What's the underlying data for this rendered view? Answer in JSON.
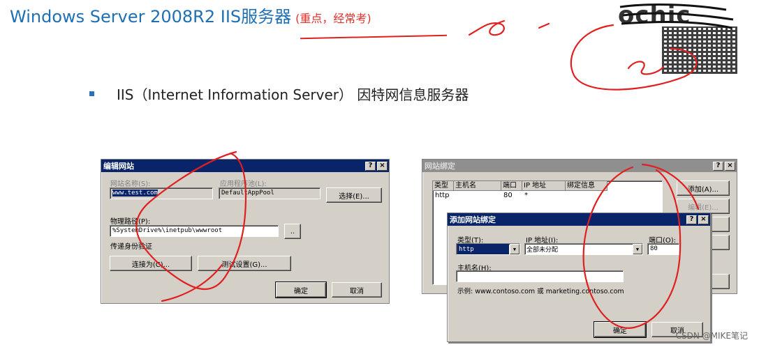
{
  "slide": {
    "title": "Windows Server 2008R2 IIS服务器",
    "title_note": "(重点，经常考)",
    "bullet": "IIS（Internet Information Server） 因特网信息服务器",
    "logo_text": "ochic",
    "watermark": "CSDN @MIKE笔记",
    "title_color": "#1f6fb5",
    "ink_color": "#e02020"
  },
  "edit_site": {
    "title": "编辑网站",
    "help_btn": "?",
    "close_btn": "×",
    "site_name_label": "网站名称(S):",
    "site_name_value": "www.test.com",
    "app_pool_label": "应用程序池(L):",
    "app_pool_value": "DefaultAppPool",
    "select_btn": "选择(E)...",
    "physical_path_label": "物理路径(P):",
    "physical_path_value": "%SystemDrive%\\inetpub\\wwwroot",
    "browse_btn": "..",
    "pass_auth_label": "传递身份验证",
    "connect_as_btn": "连接为(C)...",
    "test_settings_btn": "测试设置(G)...",
    "ok_btn": "确定",
    "cancel_btn": "取消"
  },
  "site_bindings": {
    "title": "网站绑定",
    "help_btn": "?",
    "close_btn": "×",
    "columns": [
      "类型",
      "主机名",
      "端口",
      "IP 地址",
      "绑定信息"
    ],
    "rows": [
      [
        "http",
        "",
        "80",
        "*",
        ""
      ]
    ],
    "add_btn": "添加(A)...",
    "edit_btn": "编辑(E)..."
  },
  "add_binding": {
    "title": "添加网站绑定",
    "help_btn": "?",
    "close_btn": "×",
    "type_label": "类型(T):",
    "type_value": "http",
    "ip_label": "IP 地址(I):",
    "ip_value": "全部未分配",
    "port_label": "端口(O):",
    "port_value": "80",
    "host_label": "主机名(H):",
    "host_value": "",
    "example_text": "示例: www.contoso.com 或 marketing.contoso.com",
    "ok_btn": "确定",
    "cancel_btn": "取消"
  }
}
